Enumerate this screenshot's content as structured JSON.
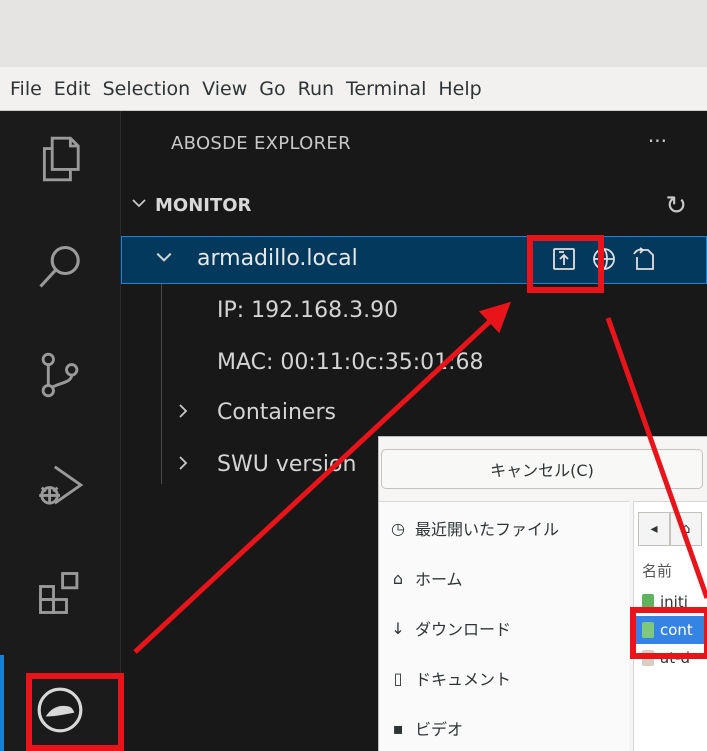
{
  "menubar": {
    "items": [
      "File",
      "Edit",
      "Selection",
      "View",
      "Go",
      "Run",
      "Terminal",
      "Help"
    ]
  },
  "activitybar": {
    "icons": [
      "explorer-icon",
      "search-icon",
      "source-control-icon",
      "run-debug-icon",
      "extensions-icon",
      "abos-icon"
    ]
  },
  "sidebar": {
    "title": "ABOSDE EXPLORER",
    "more": "···",
    "section": "MONITOR",
    "device": "armadillo.local",
    "ip": "IP: 192.168.3.90",
    "mac": "MAC: 00:11:0c:35:01:68",
    "containers": "Containers",
    "swu": "SWU version"
  },
  "dialog": {
    "cancel": "キャンセル(C)",
    "places": [
      "最近開いたファイル",
      "ホーム",
      "ダウンロード",
      "ドキュメント",
      "ビデオ"
    ],
    "column_name": "名前",
    "files": [
      "initi",
      "cont",
      "at-d"
    ]
  },
  "colors": {
    "highlight": "#e8141a",
    "selection": "#04395e",
    "accent": "#1580d8"
  }
}
